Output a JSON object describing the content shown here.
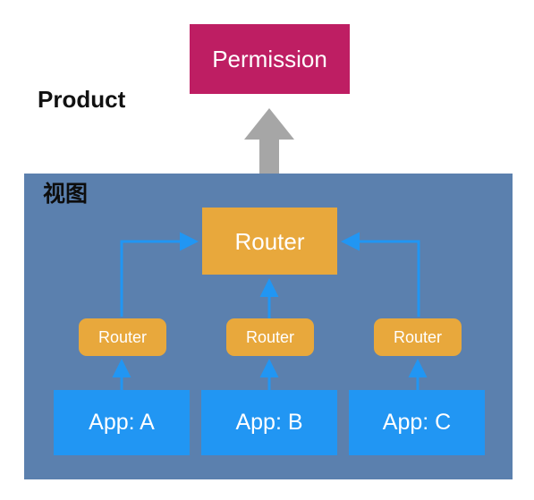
{
  "diagram": {
    "title_label": "Product",
    "view_panel_label": "视图",
    "permission": {
      "label": "Permission",
      "color": "#be1e63"
    },
    "flow_arrow": {
      "icon": "up-block-arrow",
      "color": "#a6a6a6"
    },
    "view_panel": {
      "color": "#5b80ae"
    },
    "main_router": {
      "label": "Router",
      "color": "#e8a83c"
    },
    "child_routers": [
      {
        "label": "Router",
        "color": "#e8a83c"
      },
      {
        "label": "Router",
        "color": "#e8a83c"
      },
      {
        "label": "Router",
        "color": "#e8a83c"
      }
    ],
    "apps": [
      {
        "label": "App: A",
        "color": "#2196f3"
      },
      {
        "label": "App: B",
        "color": "#2196f3"
      },
      {
        "label": "App: C",
        "color": "#2196f3"
      }
    ],
    "connector_color": "#2196f3",
    "text_color": "#ffffff",
    "background": "#ffffff"
  }
}
